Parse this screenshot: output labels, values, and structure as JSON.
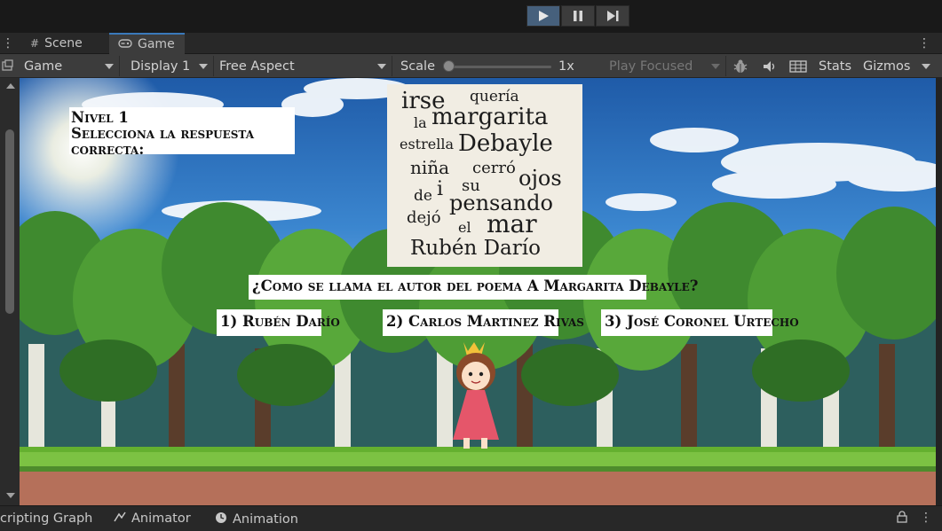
{
  "playbar": {
    "buttons": [
      {
        "name": "play",
        "icon": "play-icon",
        "active": true
      },
      {
        "name": "pause",
        "icon": "pause-icon",
        "active": false
      },
      {
        "name": "step",
        "icon": "step-icon",
        "active": false
      }
    ]
  },
  "tabs": [
    {
      "label": "Scene",
      "icon": "grid-icon",
      "active": false
    },
    {
      "label": "Game",
      "icon": "gamepad-icon",
      "active": true
    }
  ],
  "toolbar": {
    "game_dropdown": "Game",
    "display_dropdown": "Display 1",
    "aspect_dropdown": "Free Aspect",
    "scale_label": "Scale",
    "scale_value": "1x",
    "play_focused": "Play Focused",
    "stats": "Stats",
    "gizmos": "Gizmos",
    "icons": [
      "bug-icon",
      "speaker-icon",
      "grid-layout-icon"
    ]
  },
  "game": {
    "level_title": "Nivel 1",
    "instruction": "Selecciona la respuesta correcta:",
    "question": "¿Como se llama el autor del poema A Margarita Debayle?",
    "answers": [
      "1)  Rubén Darío",
      "2)  Carlos Martinez Rivas",
      "3)  José Coronel Urtecho"
    ],
    "word_cloud": [
      "irse",
      "quería",
      "la",
      "margarita",
      "estrella",
      "Debayle",
      "niña",
      "cerró",
      "ojos",
      "de",
      "i",
      "su",
      "dejó",
      "pensando",
      "el",
      "mar",
      "Rubén Darío"
    ],
    "colors": {
      "sky_top": "#1f5ba8",
      "grass": "#7cc243",
      "dirt": "#b5705a",
      "accent": "#3a79bb"
    }
  },
  "statusbar": {
    "items": [
      {
        "label": "cripting Graph",
        "icon": ""
      },
      {
        "label": "Animator",
        "icon": "animator-icon"
      },
      {
        "label": "Animation",
        "icon": "clock-icon"
      }
    ]
  }
}
